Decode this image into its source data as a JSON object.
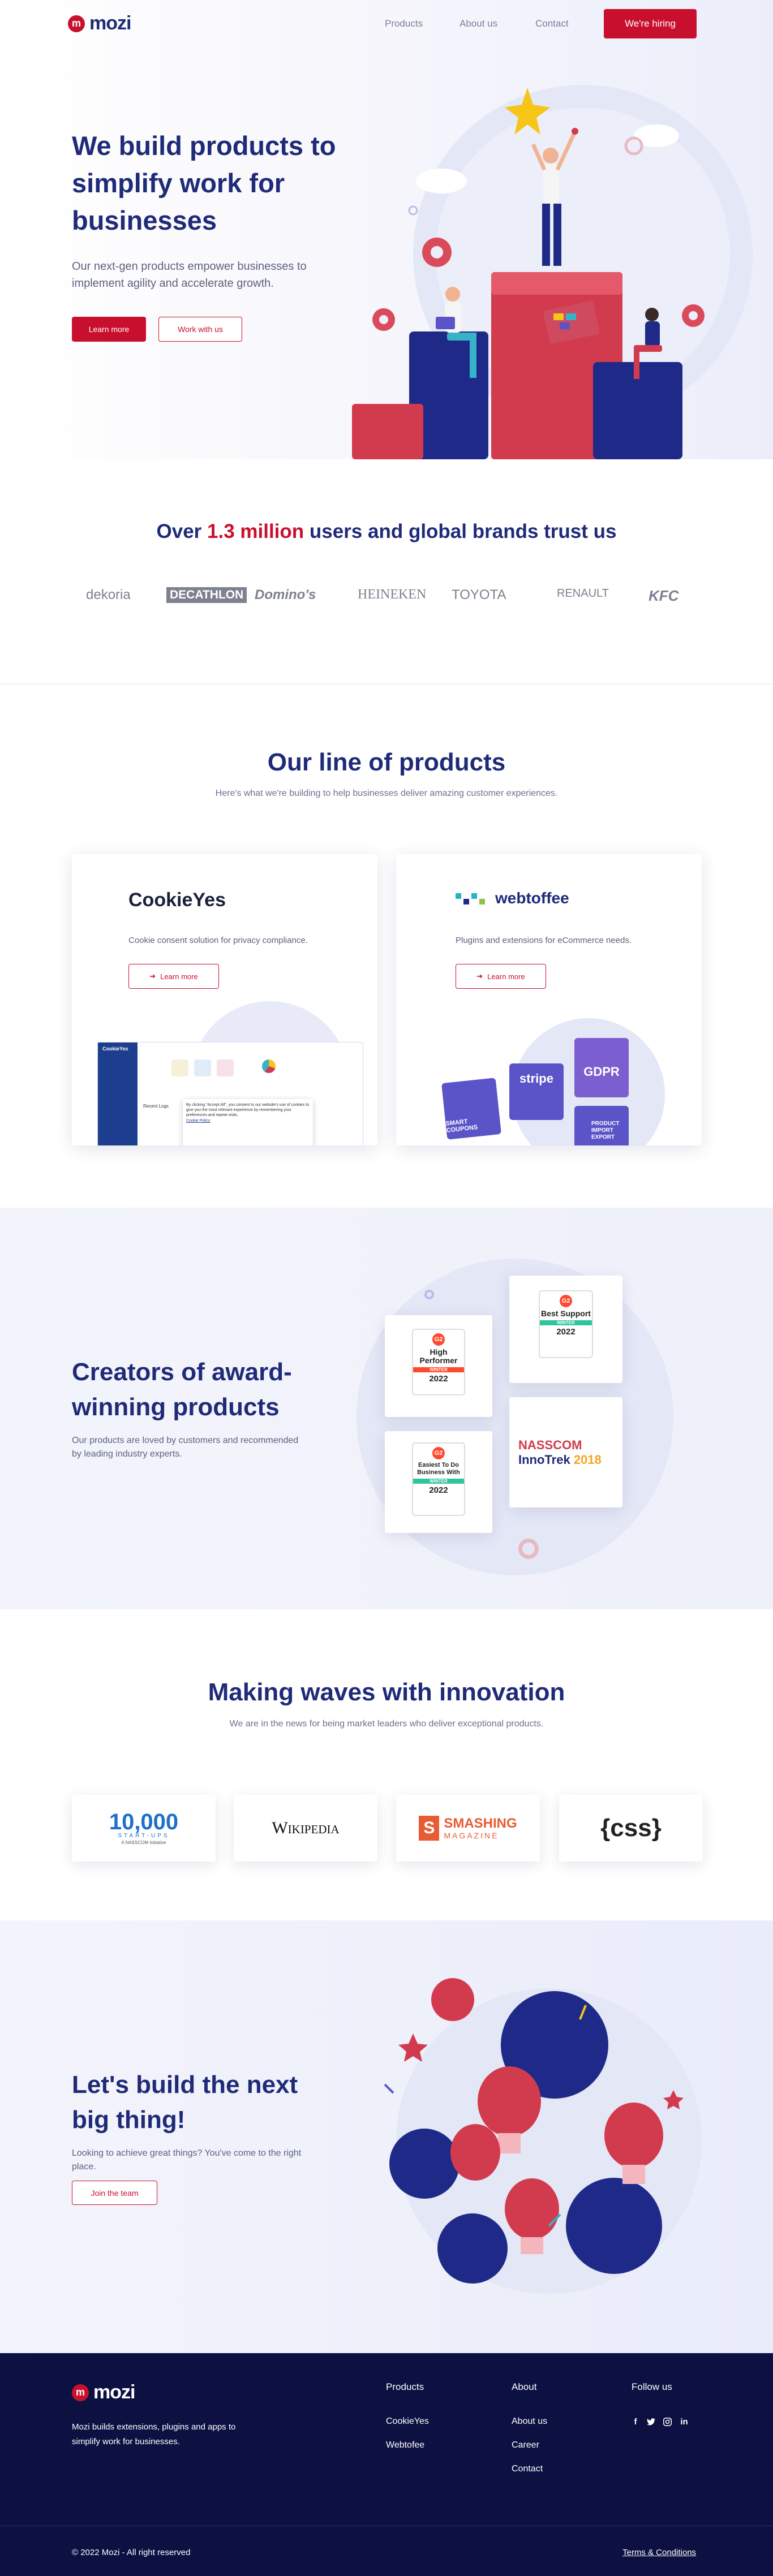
{
  "header": {
    "logo_text": "mozi",
    "logo_mark": "m",
    "nav": [
      "Products",
      "About us",
      "Contact"
    ],
    "cta_label": "We're hiring"
  },
  "hero": {
    "title": "We build products to simplify work for businesses",
    "subtitle": "Our next-gen products empower businesses to implement agility and accelerate growth.",
    "primary_button": "Learn more",
    "secondary_button": "Work with us"
  },
  "trust": {
    "title_prefix": "Over ",
    "title_highlight": "1.3 million",
    "title_suffix": " users and global brands trust us",
    "brands": [
      "dekoria",
      "DECATHLON",
      "Domino's",
      "HEINEKEN",
      "TOYOTA",
      "RENAULT",
      "KFC"
    ]
  },
  "products": {
    "title": "Our line of products",
    "subtitle": "Here's what we're building to help businesses deliver amazing customer experiences.",
    "cards": [
      {
        "name": "CookieYes",
        "description": "Cookie consent solution for privacy compliance.",
        "button": "Learn more",
        "screenshot": {
          "brand": "CookieYes",
          "banner_text": "By clicking \"Accept All\", you consent to our website's use of cookies to give you the most relevant experience by remembering your preferences and repeat visits.",
          "banner_link": "Cookie Policy",
          "section_label": "Recent Logs"
        }
      },
      {
        "name": "webtoffee",
        "description": "Plugins and extensions for eCommerce needs.",
        "button": "Learn more",
        "tiles": [
          "SMART COUPONS",
          "stripe",
          "GDPR",
          "PRODUCT IMPORT EXPORT"
        ]
      }
    ]
  },
  "awards": {
    "title": "Creators of award-winning products",
    "subtitle": "Our products are loved by customers and recommended by leading industry experts.",
    "badges": [
      {
        "brand": "G2",
        "title": "High Performer",
        "season": "WINTER",
        "year": "2022"
      },
      {
        "brand": "G2",
        "title": "Best Support",
        "season": "WINTER",
        "year": "2022"
      },
      {
        "brand": "G2",
        "title": "Easiest To Do Business With",
        "season": "WINTER",
        "year": "2022"
      },
      {
        "brand": "NASSCOM",
        "title": "InnoTrek",
        "season": "",
        "year": "2018"
      }
    ]
  },
  "news": {
    "title": "Making waves with innovation",
    "subtitle": "We are in the news for being market leaders who deliver exceptional products.",
    "outlets": [
      {
        "name": "10,000",
        "tagline": "START-UPS",
        "sub": "A NASSCOM Initiative"
      },
      {
        "name": "Wikipedia"
      },
      {
        "name": "SMASHING",
        "tagline": "MAGAZINE"
      },
      {
        "name": "{css}"
      }
    ]
  },
  "cta": {
    "title": "Let's build the next big thing!",
    "subtitle": "Looking to achieve great things? You've come to the right place.",
    "button": "Join the team"
  },
  "footer": {
    "logo_text": "mozi",
    "tagline": "Mozi builds extensions, plugins and apps to simplify work for businesses.",
    "columns": [
      {
        "heading": "Products",
        "links": [
          "CookieYes",
          "Webtofee"
        ]
      },
      {
        "heading": "About",
        "links": [
          "About us",
          "Career",
          "Contact"
        ]
      },
      {
        "heading": "Follow us",
        "links": []
      }
    ],
    "social": [
      "facebook-icon",
      "twitter-icon",
      "instagram-icon",
      "linkedin-icon"
    ],
    "copyright": "© 2022 Mozi - All right reserved",
    "terms": "Terms & Conditions"
  },
  "colors": {
    "brand_red": "#c8102e",
    "navy": "#1f2a78",
    "footer_bg": "#0d1142"
  }
}
